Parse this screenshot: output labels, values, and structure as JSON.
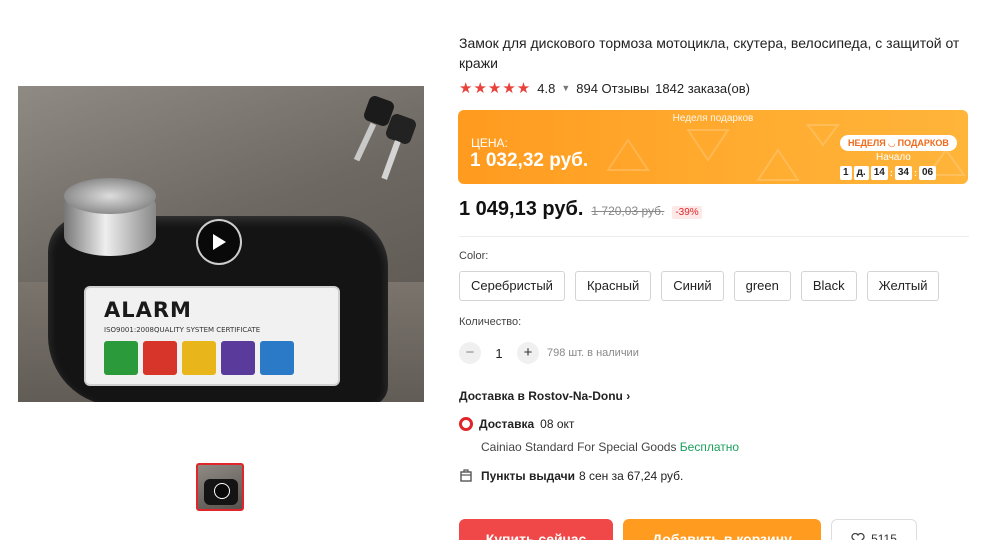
{
  "product": {
    "title": "Замок для дискового тормоза мотоцикла, скутера, велосипеда, с защитой от кражи",
    "rating": "4.8",
    "reviews": "894 Отзывы",
    "orders": "1842 заказа(ов)",
    "stars": "★★★★★",
    "image_text": {
      "brand": "ALARM",
      "cert": "ISO9001:2008QUALITY SYSTEM CERTIFICATE"
    }
  },
  "promo": {
    "event": "Неделя подарков",
    "price_label": "ЦЕНА:",
    "price": "1 032,32 руб.",
    "badge": "НЕДЕЛЯ ◡ ПОДАРКОВ",
    "start_label": "Начало",
    "timer": {
      "days": "1",
      "day_unit": "д.",
      "hours": "14",
      "minutes": "34",
      "seconds": "06"
    }
  },
  "price": {
    "current": "1 049,13 руб.",
    "old": "1 720,03 руб.",
    "discount": "-39%"
  },
  "color": {
    "label": "Color:",
    "options": [
      "Серебристый",
      "Красный",
      "Синий",
      "green",
      "Black",
      "Желтый"
    ]
  },
  "quantity": {
    "label": "Количество:",
    "minus": "−",
    "plus": "+",
    "value": "1",
    "stock": "798 шт. в наличии"
  },
  "delivery": {
    "heading": "Доставка в Rostov-Na-Donu",
    "type_label": "Доставка",
    "date": "08 окт",
    "carrier": "Cainiao Standard For Special Goods",
    "free": "Бесплатно",
    "pickup_label": "Пункты выдачи",
    "pickup_info": "8 сен за 67,24 руб."
  },
  "actions": {
    "buy": "Купить сейчас",
    "cart": "Добавить в корзину",
    "wishlist_count": "5115"
  },
  "colors": {
    "accent_red": "#e0262a",
    "promo_orange": "#ff9b1f",
    "free_green": "#1aa05a"
  }
}
